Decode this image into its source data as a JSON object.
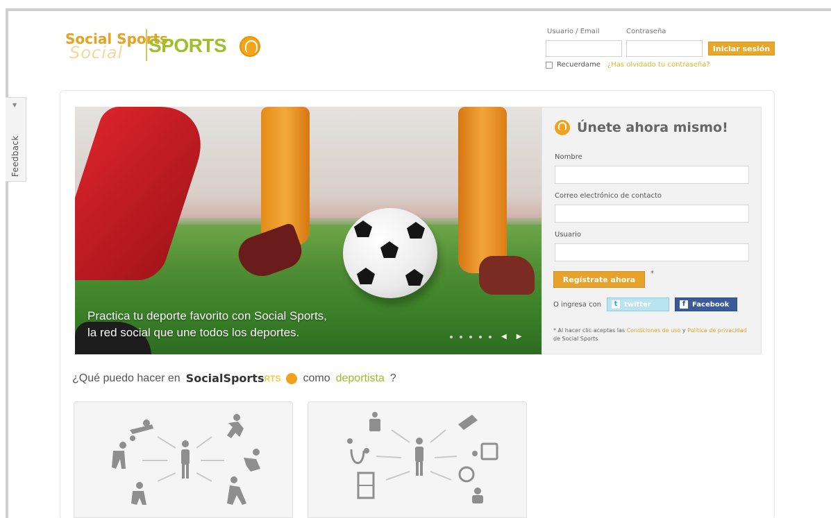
{
  "sidebar": {
    "feedback_label": "Feedback",
    "arrow": "▼"
  },
  "header": {
    "logo": {
      "social": "Social Sports",
      "social_ghost": "Social",
      "sports": "SPORTS"
    },
    "login": {
      "user_label": "Usuario / Email",
      "password_label": "Contraseña",
      "login_button": "Iniciar sesión",
      "remember_label": "Recuerdame",
      "forgot_link": "¿Has olvidado tu contraseña?"
    }
  },
  "hero": {
    "caption_line1": "Practica tu deporte favorito con Social Sports,",
    "caption_line2": "la red social que une todos los deportes.",
    "slider_dots": 5,
    "prev_icon": "◀",
    "next_icon": "▶"
  },
  "signup": {
    "title": "Únete ahora mismo!",
    "name_label": "Nombre",
    "email_label": "Correo electrónico de contacto",
    "user_label": "Usuario",
    "register_button": "Regístrate ahora",
    "asterisk": "*",
    "or_login_with": "O ingresa con",
    "twitter_label": "twitter",
    "facebook_label": "Facebook",
    "terms_prefix": "* Al hacer clic aceptas las",
    "terms_link": "Condiciones de uso",
    "terms_and": "y",
    "privacy_link": "Política de privacidad",
    "terms_suffix": "de Social Sports"
  },
  "section": {
    "question_prefix": "¿Qué puedo hacer en",
    "brand": "SocialSports",
    "brand_ghost": "RTS",
    "question_middle": "como",
    "question_highlight": "deportista",
    "question_suffix": "?"
  },
  "colors": {
    "accent": "#e8a72a",
    "green": "#9cbf2a",
    "facebook": "#3b5a98",
    "twitter": "#b8e3ef"
  },
  "icons": {
    "logo_ball": "basketball-ball-icon",
    "panel1": "athlete-network-icon",
    "panel2": "health-network-icon"
  }
}
